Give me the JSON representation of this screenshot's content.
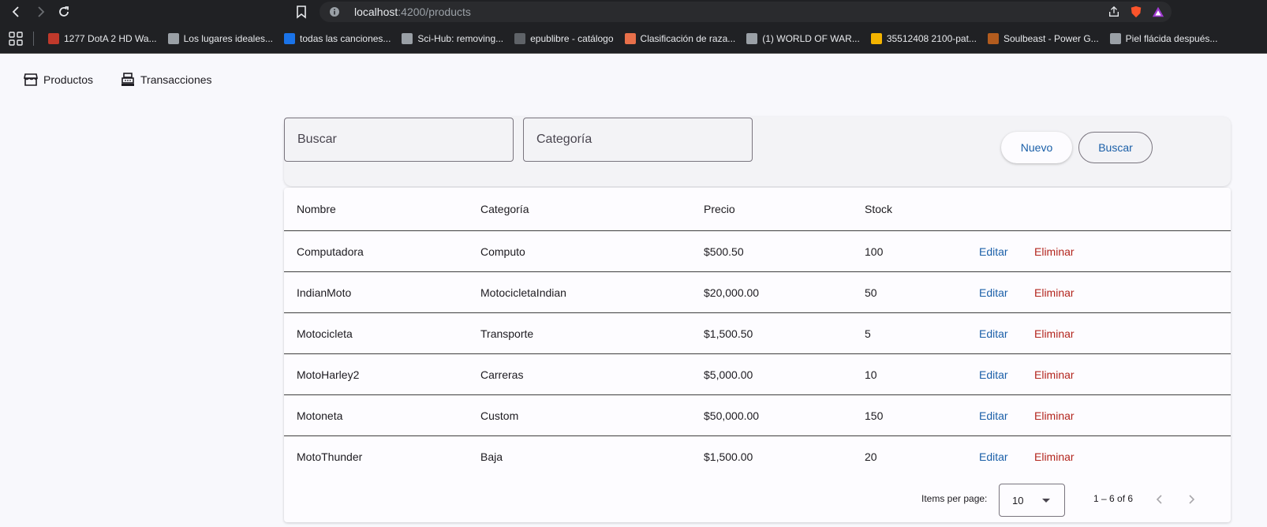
{
  "browser": {
    "url_host": "localhost",
    "url_path": ":4200/products",
    "bookmarks": [
      {
        "label": "1277 DotA 2 HD Wa...",
        "color": "#c0392b"
      },
      {
        "label": "Los lugares ideales...",
        "color": "#9aa0a6"
      },
      {
        "label": "todas las canciones...",
        "color": "#1a73e8"
      },
      {
        "label": "Sci-Hub: removing...",
        "color": "#9aa0a6"
      },
      {
        "label": "epublibre - catálogo",
        "color": "#5f6368"
      },
      {
        "label": "Clasificación de raza...",
        "color": "#e8704a"
      },
      {
        "label": "(1) WORLD OF WAR...",
        "color": "#9aa0a6"
      },
      {
        "label": "35512408 2100-pat...",
        "color": "#f4b400"
      },
      {
        "label": "Soulbeast - Power G...",
        "color": "#b35c1e"
      },
      {
        "label": "Piel flácida después...",
        "color": "#9aa0a6"
      }
    ]
  },
  "nav": {
    "products_label": "Productos",
    "transactions_label": "Transacciones"
  },
  "toolbar": {
    "search_placeholder": "Buscar",
    "category_placeholder": "Categoría",
    "new_label": "Nuevo",
    "search_label": "Buscar"
  },
  "table": {
    "headers": {
      "name": "Nombre",
      "category": "Categoría",
      "price": "Precio",
      "stock": "Stock"
    },
    "edit_label": "Editar",
    "delete_label": "Eliminar",
    "rows": [
      {
        "name": "Computadora",
        "category": "Computo",
        "price": "$500.50",
        "stock": "100"
      },
      {
        "name": "IndianMoto",
        "category": "MotocicletaIndian",
        "price": "$20,000.00",
        "stock": "50"
      },
      {
        "name": "Motocicleta",
        "category": "Transporte",
        "price": "$1,500.50",
        "stock": "5"
      },
      {
        "name": "MotoHarley2",
        "category": "Carreras",
        "price": "$5,000.00",
        "stock": "10"
      },
      {
        "name": "Motoneta",
        "category": "Custom",
        "price": "$50,000.00",
        "stock": "150"
      },
      {
        "name": "MotoThunder",
        "category": "Baja",
        "price": "$1,500.00",
        "stock": "20"
      }
    ]
  },
  "paginator": {
    "items_per_page_label": "Items per page:",
    "page_size": "10",
    "range_label": "1 – 6 of 6"
  },
  "colors": {
    "link_blue": "#1a5fa8",
    "delete_red": "#b3261e"
  }
}
